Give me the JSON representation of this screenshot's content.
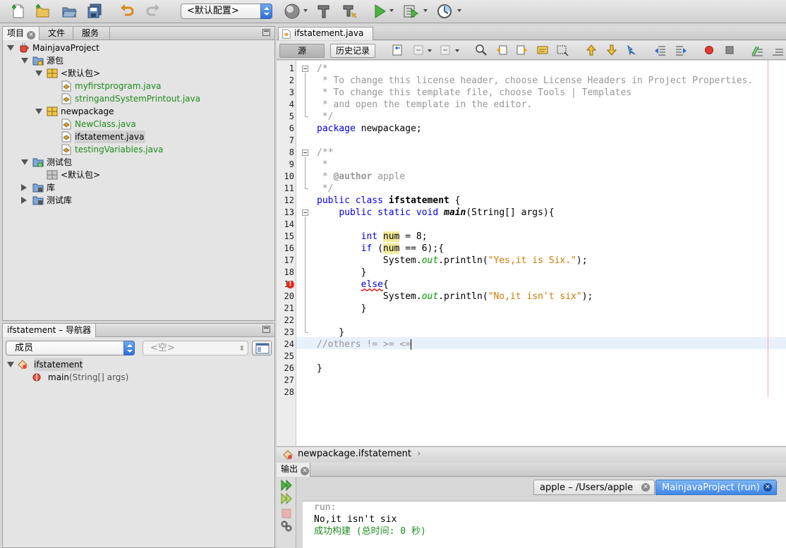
{
  "toolbar": {
    "config_value": "<默认配置>",
    "buttons": [
      "new-file-icon",
      "new-project-icon",
      "open-project-icon",
      "save-all-icon",
      "undo-icon",
      "redo-icon",
      "globe-icon",
      "build-hammer-icon",
      "clean-build-icon",
      "run-play-icon",
      "debug-icon",
      "profile-icon"
    ]
  },
  "projects_panel": {
    "tabs": [
      {
        "label": "项目",
        "closable": true
      },
      {
        "label": "文件"
      },
      {
        "label": "服务"
      }
    ],
    "tree": [
      {
        "label": "MainjavaProject",
        "depth": 0,
        "expanded": true,
        "icon": "java-project-icon"
      },
      {
        "label": "源包",
        "depth": 1,
        "expanded": true,
        "icon": "source-folder-icon"
      },
      {
        "label": "<默认包>",
        "depth": 2,
        "expanded": true,
        "icon": "package-icon"
      },
      {
        "label": "myfirstprogram.java",
        "depth": 3,
        "icon": "java-file-icon",
        "color": "#1d8c1d"
      },
      {
        "label": "stringandSystemPrintout.java",
        "depth": 3,
        "icon": "java-file-icon",
        "color": "#1d8c1d"
      },
      {
        "label": "newpackage",
        "depth": 2,
        "expanded": true,
        "icon": "package-icon"
      },
      {
        "label": "NewClass.java",
        "depth": 3,
        "icon": "java-file-icon",
        "color": "#1d8c1d"
      },
      {
        "label": "ifstatement.java",
        "depth": 3,
        "icon": "java-file-icon",
        "selected": true
      },
      {
        "label": "testingVariables.java",
        "depth": 3,
        "icon": "java-file-icon",
        "color": "#1d8c1d"
      },
      {
        "label": "测试包",
        "depth": 1,
        "expanded": true,
        "icon": "test-folder-icon"
      },
      {
        "label": "<默认包>",
        "depth": 2,
        "icon": "empty-package-icon"
      },
      {
        "label": "库",
        "depth": 1,
        "expanded": false,
        "icon": "library-icon"
      },
      {
        "label": "测试库",
        "depth": 1,
        "expanded": false,
        "icon": "library-icon"
      }
    ]
  },
  "navigator_panel": {
    "title": "ifstatement – 导航器",
    "filter_value": "成员",
    "filter2_value": "<空>",
    "tree": [
      {
        "label": "ifstatement",
        "depth": 0,
        "expanded": true,
        "icon": "class-icon"
      },
      {
        "label_main": "main",
        "label_params": "(String[] args)",
        "depth": 1,
        "icon": "method-icon"
      }
    ]
  },
  "editor": {
    "tab_label": "ifstatement.java",
    "source_button": "源",
    "history_button": "历史记录",
    "breadcrumb": "newpackage.ifstatement",
    "lines": [
      [
        {
          "t": "/*",
          "c": "com"
        }
      ],
      [
        {
          "t": " * To change this license header, choose License Headers in Project Properties.",
          "c": "com"
        }
      ],
      [
        {
          "t": " * To change this template file, choose Tools | Templates",
          "c": "com"
        }
      ],
      [
        {
          "t": " * and open the template in the editor.",
          "c": "com"
        }
      ],
      [
        {
          "t": " */",
          "c": "com"
        }
      ],
      [
        {
          "t": "package",
          "c": "kw"
        },
        {
          "t": " newpackage;"
        }
      ],
      [],
      [
        {
          "t": "/**",
          "c": "com"
        }
      ],
      [
        {
          "t": " *",
          "c": "com"
        }
      ],
      [
        {
          "t": " * ",
          "c": "com"
        },
        {
          "t": "@author",
          "c": "com b"
        },
        {
          "t": " apple",
          "c": "com"
        }
      ],
      [
        {
          "t": " */",
          "c": "com"
        }
      ],
      [
        {
          "t": "public",
          "c": "kw"
        },
        {
          "t": " "
        },
        {
          "t": "class",
          "c": "kw"
        },
        {
          "t": " "
        },
        {
          "t": "ifstatement",
          "c": "b"
        },
        {
          "t": " {"
        }
      ],
      [
        {
          "t": "    "
        },
        {
          "t": "public",
          "c": "kw"
        },
        {
          "t": " "
        },
        {
          "t": "static",
          "c": "kw"
        },
        {
          "t": " "
        },
        {
          "t": "void",
          "c": "kw"
        },
        {
          "t": " "
        },
        {
          "t": "main",
          "c": "bi"
        },
        {
          "t": "(String[] args){"
        }
      ],
      [],
      [
        {
          "t": "        "
        },
        {
          "t": "int",
          "c": "kw"
        },
        {
          "t": " "
        },
        {
          "t": "num",
          "c": "hl"
        },
        {
          "t": " = 8;"
        }
      ],
      [
        {
          "t": "        "
        },
        {
          "t": "if",
          "c": "kw"
        },
        {
          "t": " ("
        },
        {
          "t": "num",
          "c": "hl"
        },
        {
          "t": " == 6);{"
        }
      ],
      [
        {
          "t": "            System."
        },
        {
          "t": "out",
          "c": "fld"
        },
        {
          "t": ".println("
        },
        {
          "t": "\"Yes,it is Six.\"",
          "c": "str"
        },
        {
          "t": ");"
        }
      ],
      [
        {
          "t": "        }"
        }
      ],
      [
        {
          "t": "        "
        },
        {
          "t": "else",
          "c": "kw err"
        },
        {
          "t": "{"
        }
      ],
      [
        {
          "t": "            System."
        },
        {
          "t": "out",
          "c": "fld"
        },
        {
          "t": ".println("
        },
        {
          "t": "\"No,it isn't six\"",
          "c": "str"
        },
        {
          "t": ");"
        }
      ],
      [
        {
          "t": "        }"
        }
      ],
      [],
      [
        {
          "t": "    }"
        }
      ],
      [
        {
          "t": "//others != >= <=",
          "c": "com"
        }
      ],
      [],
      [
        {
          "t": "}"
        }
      ],
      [],
      []
    ]
  },
  "output": {
    "tab_label": "输出",
    "session_tabs": [
      {
        "label": "apple – /Users/apple",
        "active": false
      },
      {
        "label": "MainjavaProject (run)",
        "active": true
      }
    ],
    "console": [
      {
        "text": "run:",
        "color": "#888888"
      },
      {
        "text": "No,it isn't six",
        "color": "#000000"
      },
      {
        "text": "成功构建 (总时间: 0 秒)",
        "color": "#1d8c1d"
      }
    ]
  }
}
